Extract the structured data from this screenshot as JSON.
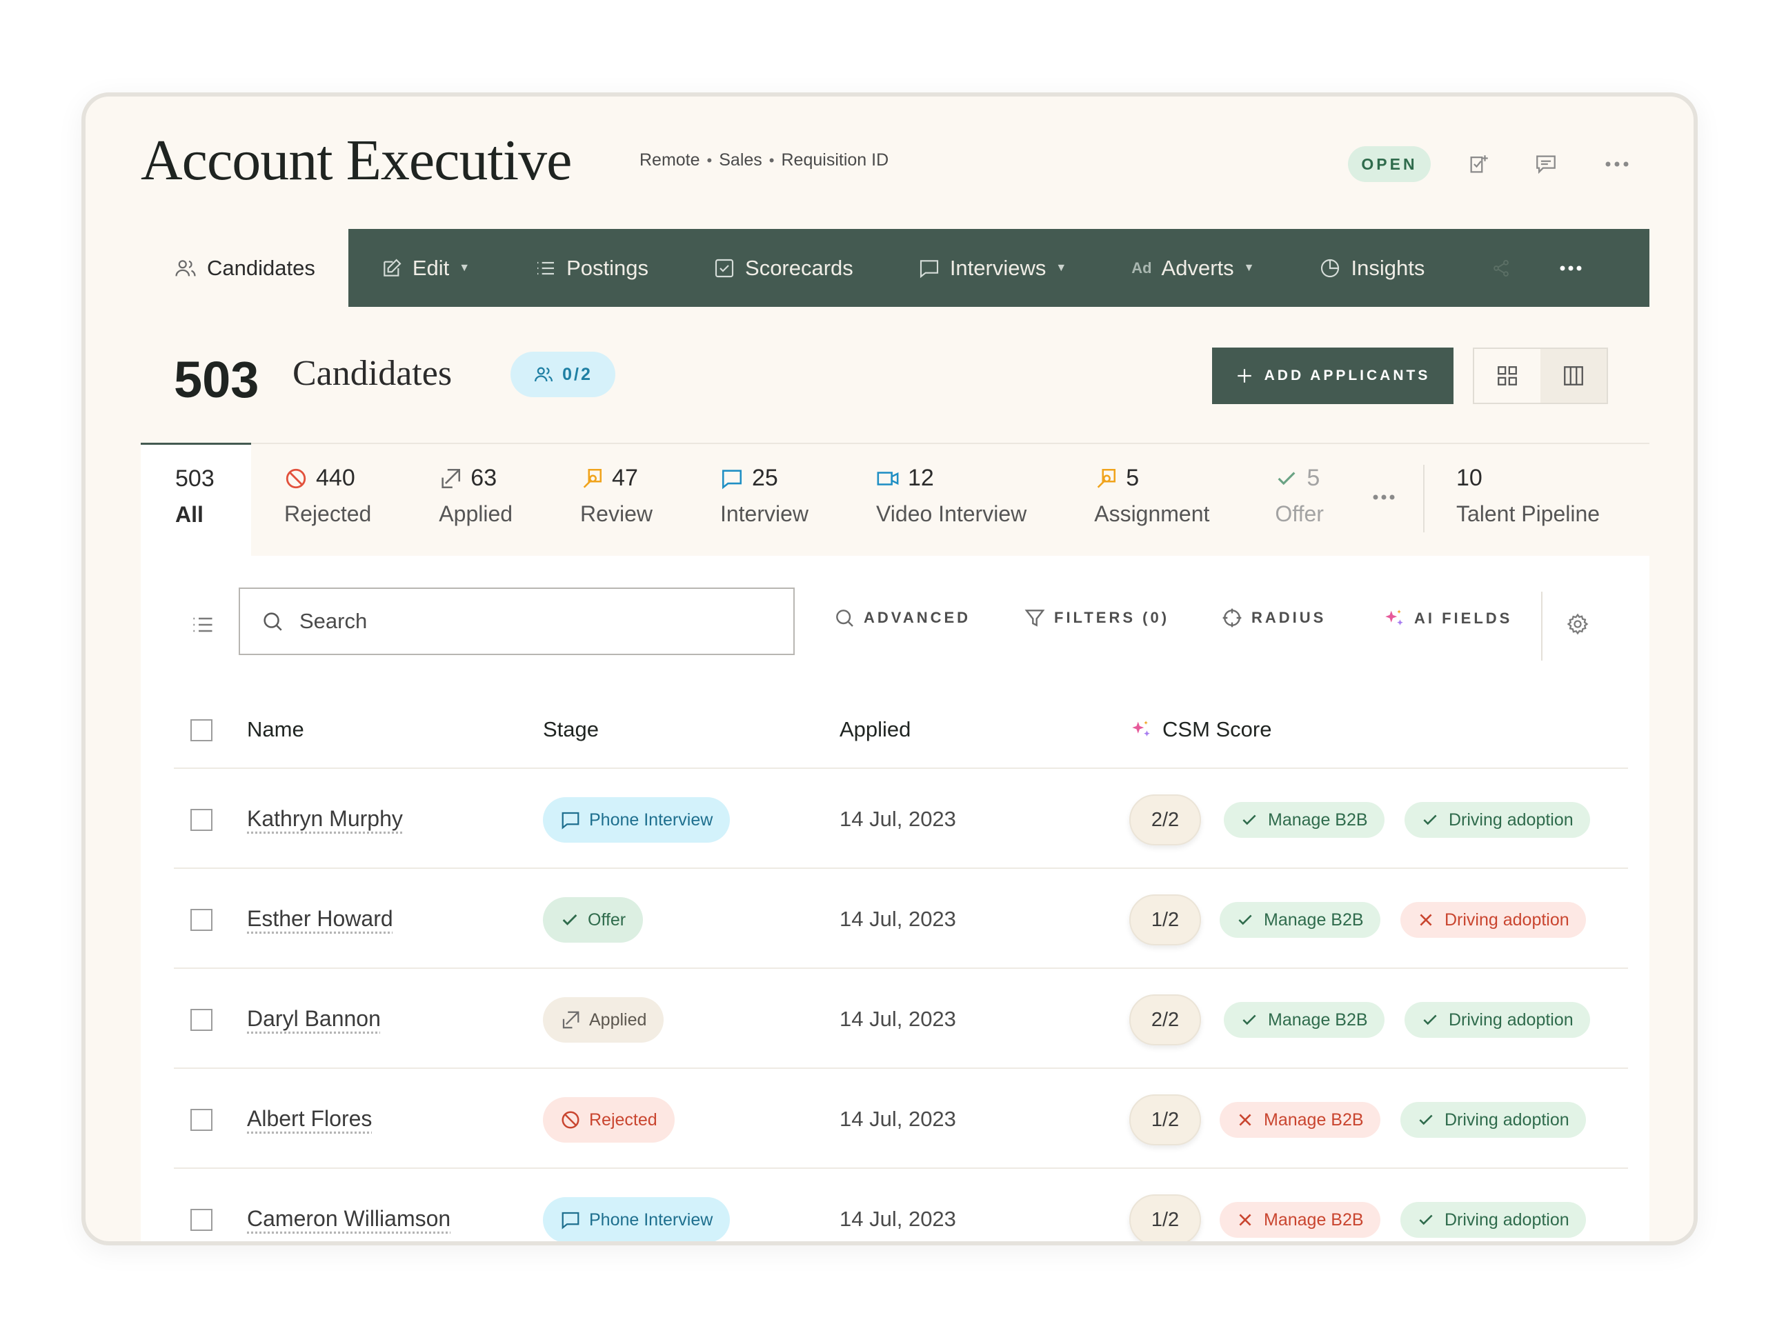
{
  "header": {
    "title": "Account Executive",
    "meta": [
      "Remote",
      "Sales",
      "Requisition ID"
    ],
    "status": "OPEN"
  },
  "nav": {
    "items": [
      {
        "label": "Candidates",
        "icon": "users-icon",
        "active": true
      },
      {
        "label": "Edit",
        "icon": "edit-icon",
        "dropdown": true
      },
      {
        "label": "Postings",
        "icon": "list-icon"
      },
      {
        "label": "Scorecards",
        "icon": "checkbox-icon"
      },
      {
        "label": "Interviews",
        "icon": "chat-icon",
        "dropdown": true
      },
      {
        "label": "Adverts",
        "icon": "ad-icon",
        "dropdown": true
      },
      {
        "label": "Insights",
        "icon": "pie-chart-icon"
      }
    ]
  },
  "summary": {
    "count": "503",
    "label": "Candidates",
    "team": "0/2",
    "add_label": "ADD APPLICANTS"
  },
  "stages": [
    {
      "count": "503",
      "label": "All"
    },
    {
      "count": "440",
      "label": "Rejected"
    },
    {
      "count": "63",
      "label": "Applied"
    },
    {
      "count": "47",
      "label": "Review"
    },
    {
      "count": "25",
      "label": "Interview"
    },
    {
      "count": "12",
      "label": "Video Interview"
    },
    {
      "count": "5",
      "label": "Assignment"
    },
    {
      "count": "5",
      "label": "Offer"
    },
    {
      "count": "10",
      "label": "Talent Pipeline"
    }
  ],
  "toolbar": {
    "search_placeholder": "Search",
    "advanced": "ADVANCED",
    "filters": "FILTERS (0)",
    "radius": "RADIUS",
    "ai_fields": "AI FIELDS"
  },
  "table": {
    "headers": {
      "name": "Name",
      "stage": "Stage",
      "applied": "Applied",
      "score": "CSM Score"
    },
    "rows": [
      {
        "name": "Kathryn Murphy",
        "stage": "Phone Interview",
        "applied": "14 Jul, 2023",
        "score": "2/2",
        "tag1": "Manage B2B",
        "tag2": "Driving adoption"
      },
      {
        "name": "Esther Howard",
        "stage": "Offer",
        "applied": "14 Jul, 2023",
        "score": "1/2",
        "tag1": "Manage B2B",
        "tag2": "Driving adoption"
      },
      {
        "name": "Daryl Bannon",
        "stage": "Applied",
        "applied": "14 Jul, 2023",
        "score": "2/2",
        "tag1": "Manage B2B",
        "tag2": "Driving adoption"
      },
      {
        "name": "Albert Flores",
        "stage": "Rejected",
        "applied": "14 Jul, 2023",
        "score": "1/2",
        "tag1": "Manage B2B",
        "tag2": "Driving adoption"
      },
      {
        "name": "Cameron Williamson",
        "stage": "Phone Interview",
        "applied": "14 Jul, 2023",
        "score": "1/2",
        "tag1": "Manage B2B",
        "tag2": "Driving adoption"
      }
    ]
  },
  "colors": {
    "nav_bg": "#445a51",
    "card_bg": "#fcf8f2",
    "ok": "#2f6b4c",
    "bad": "#c9452f",
    "phone": "#1e6f8e"
  }
}
